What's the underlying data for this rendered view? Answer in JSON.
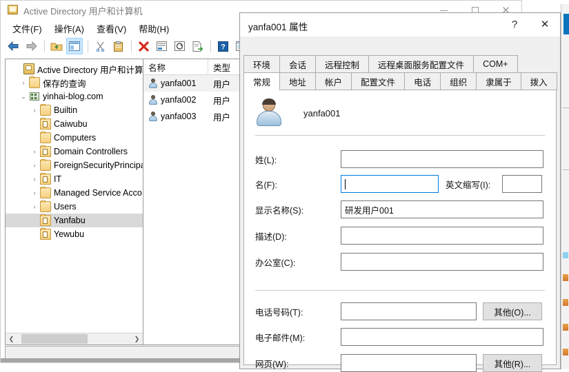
{
  "main_window": {
    "title": "Active Directory 用户和计算机",
    "icon": "console-icon",
    "window_buttons": [
      {
        "name": "minimize-button",
        "glyph": "—"
      },
      {
        "name": "maximize-button",
        "glyph": "□"
      },
      {
        "name": "close-button",
        "glyph": "✕"
      }
    ],
    "menu": [
      "文件(F)",
      "操作(A)",
      "查看(V)",
      "帮助(H)"
    ],
    "toolbar_icons": [
      "back-arrow-icon",
      "forward-arrow-icon",
      "up-folder-icon",
      "show-hide-tree-icon",
      "cut-icon",
      "paste-icon",
      "delete-icon",
      "properties-icon",
      "refresh-icon",
      "export-list-icon",
      "help-icon",
      "console-view-icon",
      "new-user-icon"
    ],
    "tree": [
      {
        "label": "Active Directory 用户和计算机",
        "icon": "console-icon",
        "indent": 0,
        "chevron": "",
        "selected": false
      },
      {
        "label": "保存的查询",
        "icon": "folder-icon",
        "indent": 1,
        "chevron": "›",
        "selected": false
      },
      {
        "label": "yinhai-blog.com",
        "icon": "domain-icon",
        "indent": 1,
        "chevron": "⌄",
        "selected": false
      },
      {
        "label": "Builtin",
        "icon": "folder-icon",
        "indent": 2,
        "chevron": "›",
        "selected": false
      },
      {
        "label": "Caiwubu",
        "icon": "ou-icon",
        "indent": 2,
        "chevron": "",
        "selected": false
      },
      {
        "label": "Computers",
        "icon": "folder-icon",
        "indent": 2,
        "chevron": "",
        "selected": false
      },
      {
        "label": "Domain Controllers",
        "icon": "ou-icon",
        "indent": 2,
        "chevron": "›",
        "selected": false
      },
      {
        "label": "ForeignSecurityPrincipa",
        "icon": "folder-icon",
        "indent": 2,
        "chevron": "›",
        "selected": false
      },
      {
        "label": "IT",
        "icon": "ou-icon",
        "indent": 2,
        "chevron": "›",
        "selected": false
      },
      {
        "label": "Managed Service Acco",
        "icon": "folder-icon",
        "indent": 2,
        "chevron": "›",
        "selected": false
      },
      {
        "label": "Users",
        "icon": "folder-icon",
        "indent": 2,
        "chevron": "›",
        "selected": false
      },
      {
        "label": "Yanfabu",
        "icon": "ou-icon",
        "indent": 2,
        "chevron": "",
        "selected": true
      },
      {
        "label": "Yewubu",
        "icon": "ou-icon",
        "indent": 2,
        "chevron": "",
        "selected": false
      }
    ],
    "list": {
      "columns": [
        "名称",
        "类型"
      ],
      "rows": [
        {
          "name": "yanfa001",
          "type": "用户",
          "selected": true
        },
        {
          "name": "yanfa002",
          "type": "用户",
          "selected": false
        },
        {
          "name": "yanfa003",
          "type": "用户",
          "selected": false
        }
      ]
    }
  },
  "dialog": {
    "title": "yanfa001 属性",
    "help_button": "?",
    "close_button": "✕",
    "tabs_row1": [
      "环境",
      "会话",
      "远程控制",
      "远程桌面服务配置文件",
      "COM+"
    ],
    "tabs_row2": [
      "常规",
      "地址",
      "帐户",
      "配置文件",
      "电话",
      "组织",
      "隶属于",
      "拨入"
    ],
    "active_tab": "常规",
    "account_name": "yanfa001",
    "fields": {
      "last_name": {
        "label": "姓(L):",
        "value": ""
      },
      "first_name": {
        "label": "名(F):",
        "value": ""
      },
      "initials": {
        "label": "英文缩写(I):",
        "value": ""
      },
      "display_name": {
        "label": "显示名称(S):",
        "value": "研发用户001"
      },
      "description": {
        "label": "描述(D):",
        "value": ""
      },
      "office": {
        "label": "办公室(C):",
        "value": ""
      },
      "telephone": {
        "label": "电话号码(T):",
        "value": ""
      },
      "email": {
        "label": "电子邮件(M):",
        "value": ""
      },
      "webpage": {
        "label": "网页(W):",
        "value": ""
      }
    },
    "buttons": {
      "telephone_other": "其他(O)...",
      "webpage_other": "其他(R)..."
    }
  },
  "colors": {
    "accent": "#0078d7",
    "selection": "#d9d9d9",
    "dialog_bg": "#f0f0f0",
    "border": "#9b9b9b"
  }
}
